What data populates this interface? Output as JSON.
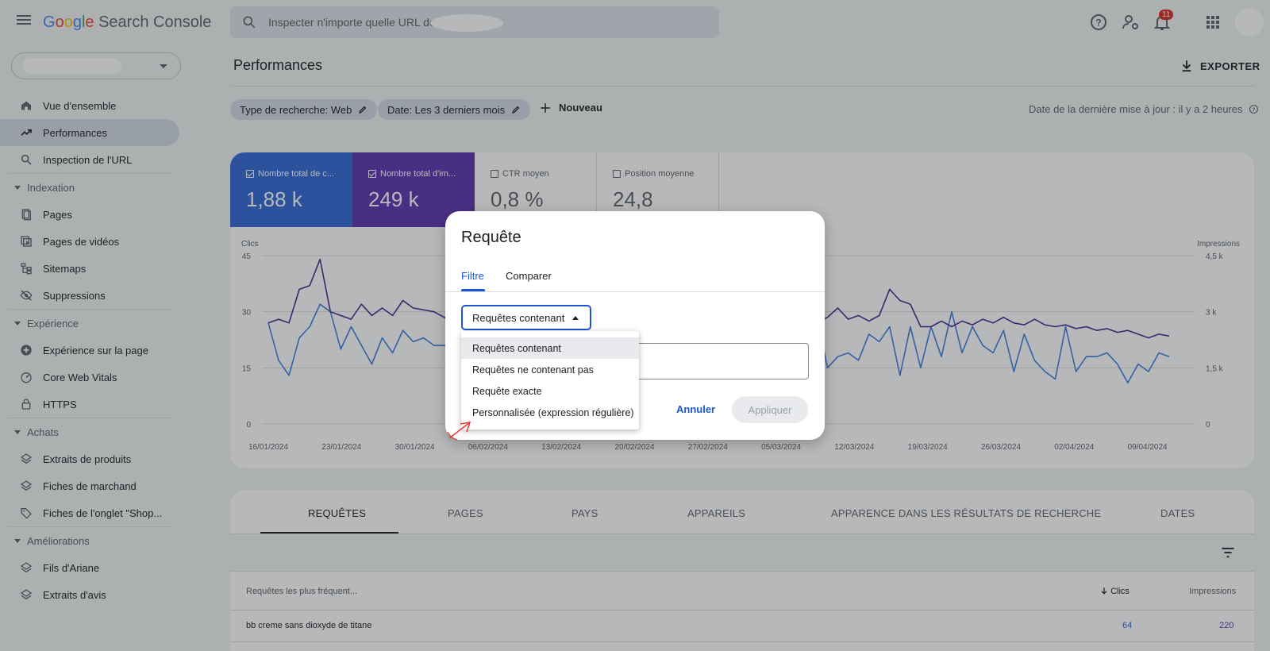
{
  "header": {
    "logo_google": "Google",
    "logo_product": "Search Console",
    "search_placeholder": "Inspecter n'importe quelle URL de",
    "notifications_count": "11"
  },
  "sidebar": {
    "items": [
      {
        "type": "item",
        "label": "Vue d'ensemble",
        "icon": "home-icon"
      },
      {
        "type": "item",
        "label": "Performances",
        "icon": "trending-up-icon",
        "active": true
      },
      {
        "type": "item",
        "label": "Inspection de l'URL",
        "icon": "search-icon"
      },
      {
        "type": "section",
        "label": "Indexation"
      },
      {
        "type": "item",
        "label": "Pages",
        "icon": "pages-icon"
      },
      {
        "type": "item",
        "label": "Pages de vidéos",
        "icon": "video-pages-icon"
      },
      {
        "type": "item",
        "label": "Sitemaps",
        "icon": "sitemap-icon"
      },
      {
        "type": "item",
        "label": "Suppressions",
        "icon": "eye-off-icon"
      },
      {
        "type": "section",
        "label": "Expérience"
      },
      {
        "type": "item",
        "label": "Expérience sur la page",
        "icon": "plus-circle-icon"
      },
      {
        "type": "item",
        "label": "Core Web Vitals",
        "icon": "gauge-icon"
      },
      {
        "type": "item",
        "label": "HTTPS",
        "icon": "lock-icon"
      },
      {
        "type": "section",
        "label": "Achats"
      },
      {
        "type": "item",
        "label": "Extraits de produits",
        "icon": "layers-icon"
      },
      {
        "type": "item",
        "label": "Fiches de marchand",
        "icon": "layers-icon"
      },
      {
        "type": "item",
        "label": "Fiches de l'onglet \"Shop...",
        "icon": "tag-icon"
      },
      {
        "type": "section",
        "label": "Améliorations"
      },
      {
        "type": "item",
        "label": "Fils d'Ariane",
        "icon": "layers-icon"
      },
      {
        "type": "item",
        "label": "Extraits d'avis",
        "icon": "layers-icon"
      }
    ]
  },
  "main": {
    "title": "Performances",
    "export_label": "EXPORTER",
    "chips": [
      "Type de recherche: Web",
      "Date: Les 3 derniers mois"
    ],
    "new_label": "Nouveau",
    "updated_text": "Date de la dernière mise à jour : il y a 2 heures",
    "metrics": [
      {
        "label": "Nombre total de c...",
        "value": "1,88 k",
        "checked": true,
        "color": "#3367d6"
      },
      {
        "label": "Nombre total d'im...",
        "value": "249 k",
        "checked": true,
        "color": "#5e35b1"
      },
      {
        "label": "CTR moyen",
        "value": "0,8 %",
        "checked": false
      },
      {
        "label": "Position moyenne",
        "value": "24,8",
        "checked": false
      }
    ]
  },
  "chart_data": {
    "type": "line",
    "ylabel_left": "Clics",
    "ylabel_right": "Impressions",
    "y_ticks_left": [
      "45",
      "30",
      "15",
      "0"
    ],
    "y_ticks_right": [
      "4,5 k",
      "3 k",
      "1,5 k",
      "0"
    ],
    "ylim_left": [
      0,
      45
    ],
    "ylim_right": [
      0,
      4500
    ],
    "x_ticks": [
      "16/01/2024",
      "23/01/2024",
      "30/01/2024",
      "06/02/2024",
      "13/02/2024",
      "20/02/2024",
      "27/02/2024",
      "05/03/2024",
      "12/03/2024",
      "19/03/2024",
      "26/03/2024",
      "02/04/2024",
      "09/04/2024"
    ],
    "series": [
      {
        "name": "Clics",
        "color": "#3f7fe0",
        "axis": "left",
        "values": [
          27,
          17,
          13,
          23,
          26,
          32,
          30,
          20,
          26,
          21,
          16,
          23,
          19,
          25,
          22,
          23,
          21,
          21,
          20,
          21,
          22,
          20,
          19,
          18,
          20,
          19,
          18,
          19,
          20,
          19,
          18,
          19,
          20,
          19,
          18,
          19,
          20,
          19,
          20,
          19,
          18,
          19,
          20,
          19,
          18,
          19,
          20,
          19,
          18,
          24,
          23,
          16,
          26,
          29,
          15,
          18,
          19,
          17,
          24,
          22,
          26,
          13,
          26,
          15,
          26,
          18,
          30,
          19,
          26,
          21,
          19,
          25,
          14,
          24,
          17,
          14,
          12,
          26,
          14,
          18,
          18,
          19,
          16,
          11,
          16,
          14,
          19,
          18
        ]
      },
      {
        "name": "Impressions",
        "color": "#4a2a8c",
        "axis": "right",
        "values": [
          2700,
          2800,
          2700,
          3600,
          3700,
          4400,
          3000,
          2900,
          2800,
          3200,
          2900,
          3100,
          2900,
          3300,
          3100,
          3050,
          3000,
          2850,
          2650,
          2600,
          2550,
          2600,
          2500,
          2600,
          2550,
          2500,
          2600,
          2550,
          2500,
          2600,
          2550,
          2500,
          2600,
          2550,
          2500,
          2600,
          2550,
          2500,
          2600,
          2550,
          2500,
          2600,
          2550,
          2500,
          2600,
          2550,
          2500,
          2600,
          2550,
          2600,
          2700,
          2750,
          2650,
          2700,
          2850,
          3100,
          2800,
          2900,
          2750,
          2900,
          3600,
          3300,
          3200,
          2600,
          2600,
          2750,
          2600,
          2750,
          2650,
          2800,
          2700,
          2850,
          2700,
          2650,
          2800,
          2650,
          2600,
          2650,
          2550,
          2600,
          2500,
          2550,
          2450,
          2500,
          2400,
          2300,
          2400,
          2350
        ]
      }
    ]
  },
  "table": {
    "tabs": [
      "REQUÊTES",
      "PAGES",
      "PAYS",
      "APPAREILS",
      "APPARENCE DANS LES RÉSULTATS DE RECHERCHE",
      "DATES"
    ],
    "columns": [
      "Requêtes les plus fréquent...",
      "Clics",
      "Impressions"
    ],
    "rows": [
      {
        "query": "bb creme sans dioxyde de titane",
        "clicks": "64",
        "impressions": "220"
      }
    ]
  },
  "dialog": {
    "title": "Requête",
    "tabs": [
      "Filtre",
      "Comparer"
    ],
    "select_value": "Requêtes contenant",
    "cancel_label": "Annuler",
    "apply_label": "Appliquer",
    "options": [
      "Requêtes contenant",
      "Requêtes ne contenant pas",
      "Requête exacte",
      "Personnalisée (expression régulière)"
    ]
  }
}
